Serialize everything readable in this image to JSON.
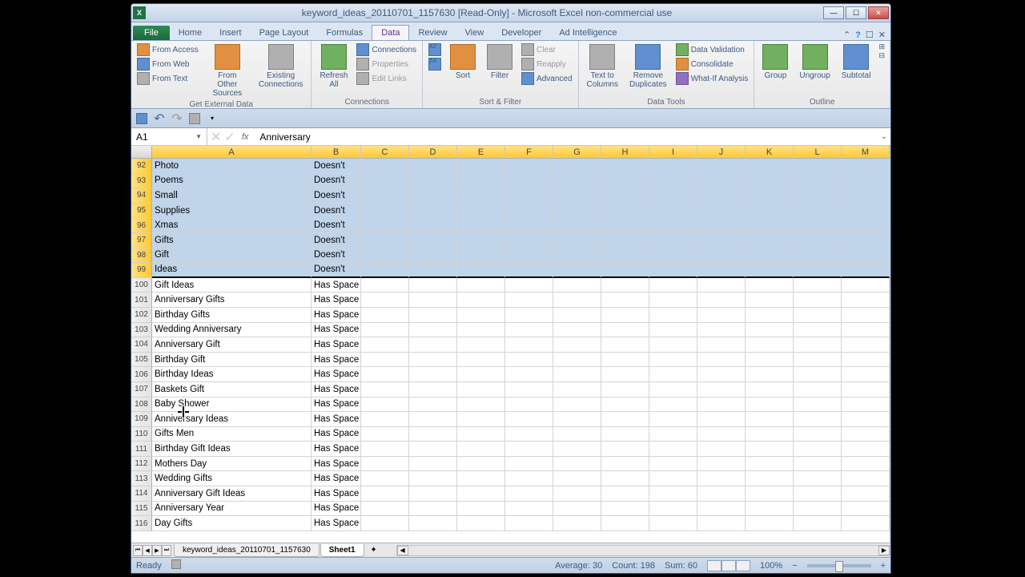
{
  "window": {
    "title": "keyword_ideas_20110701_1157630 [Read-Only] - Microsoft Excel non-commercial use"
  },
  "ribbon_tabs": {
    "file": "File",
    "items": [
      "Home",
      "Insert",
      "Page Layout",
      "Formulas",
      "Data",
      "Review",
      "View",
      "Developer",
      "Ad Intelligence"
    ],
    "active_index": 4
  },
  "ribbon": {
    "groups": {
      "get_external_data": {
        "label": "Get External Data",
        "from_access": "From Access",
        "from_web": "From Web",
        "from_text": "From Text",
        "from_other": "From Other Sources",
        "existing": "Existing Connections"
      },
      "connections": {
        "label": "Connections",
        "refresh": "Refresh All",
        "connections": "Connections",
        "properties": "Properties",
        "edit_links": "Edit Links"
      },
      "sort_filter": {
        "label": "Sort & Filter",
        "sort": "Sort",
        "filter": "Filter",
        "clear": "Clear",
        "reapply": "Reapply",
        "advanced": "Advanced"
      },
      "data_tools": {
        "label": "Data Tools",
        "text_to_cols": "Text to Columns",
        "remove_dup": "Remove Duplicates",
        "validation": "Data Validation",
        "consolidate": "Consolidate",
        "whatif": "What-If Analysis"
      },
      "outline": {
        "label": "Outline",
        "group": "Group",
        "ungroup": "Ungroup",
        "subtotal": "Subtotal"
      }
    }
  },
  "namebox": {
    "value": "A1"
  },
  "formula_bar": {
    "value": "Anniversary"
  },
  "columns": [
    "A",
    "B",
    "C",
    "D",
    "E",
    "F",
    "G",
    "H",
    "I",
    "J",
    "K",
    "L",
    "M"
  ],
  "selection_end_row": 99,
  "rows": [
    {
      "n": 92,
      "a": "Photo",
      "b": "Doesn't",
      "sel": true
    },
    {
      "n": 93,
      "a": "Poems",
      "b": "Doesn't",
      "sel": true
    },
    {
      "n": 94,
      "a": "Small",
      "b": "Doesn't",
      "sel": true
    },
    {
      "n": 95,
      "a": "Supplies",
      "b": "Doesn't",
      "sel": true
    },
    {
      "n": 96,
      "a": "Xmas",
      "b": "Doesn't",
      "sel": true
    },
    {
      "n": 97,
      "a": "Gifts",
      "b": "Doesn't",
      "sel": true
    },
    {
      "n": 98,
      "a": "Gift",
      "b": "Doesn't",
      "sel": true
    },
    {
      "n": 99,
      "a": "Ideas",
      "b": "Doesn't",
      "sel": true
    },
    {
      "n": 100,
      "a": "Gift Ideas",
      "b": "Has Space",
      "sel": false
    },
    {
      "n": 101,
      "a": "Anniversary Gifts",
      "b": "Has Space",
      "sel": false
    },
    {
      "n": 102,
      "a": "Birthday Gifts",
      "b": "Has Space",
      "sel": false
    },
    {
      "n": 103,
      "a": "Wedding Anniversary",
      "b": "Has Space",
      "sel": false
    },
    {
      "n": 104,
      "a": "Anniversary Gift",
      "b": "Has Space",
      "sel": false
    },
    {
      "n": 105,
      "a": "Birthday Gift",
      "b": "Has Space",
      "sel": false
    },
    {
      "n": 106,
      "a": "Birthday Ideas",
      "b": "Has Space",
      "sel": false
    },
    {
      "n": 107,
      "a": "Baskets Gift",
      "b": "Has Space",
      "sel": false
    },
    {
      "n": 108,
      "a": "Baby Shower",
      "b": "Has Space",
      "sel": false
    },
    {
      "n": 109,
      "a": "Anniversary Ideas",
      "b": "Has Space",
      "sel": false
    },
    {
      "n": 110,
      "a": "Gifts Men",
      "b": "Has Space",
      "sel": false
    },
    {
      "n": 111,
      "a": "Birthday Gift Ideas",
      "b": "Has Space",
      "sel": false
    },
    {
      "n": 112,
      "a": "Mothers Day",
      "b": "Has Space",
      "sel": false
    },
    {
      "n": 113,
      "a": "Wedding Gifts",
      "b": "Has Space",
      "sel": false
    },
    {
      "n": 114,
      "a": "Anniversary Gift Ideas",
      "b": "Has Space",
      "sel": false
    },
    {
      "n": 115,
      "a": "Anniversary Year",
      "b": "Has Space",
      "sel": false
    },
    {
      "n": 116,
      "a": "Day Gifts",
      "b": "Has Space",
      "sel": false
    }
  ],
  "sheets": {
    "tabs": [
      "keyword_ideas_20110701_1157630",
      "Sheet1"
    ],
    "active_index": 1
  },
  "statusbar": {
    "mode": "Ready",
    "average": "Average: 30",
    "count": "Count: 198",
    "sum": "Sum: 60",
    "zoom": "100%"
  }
}
